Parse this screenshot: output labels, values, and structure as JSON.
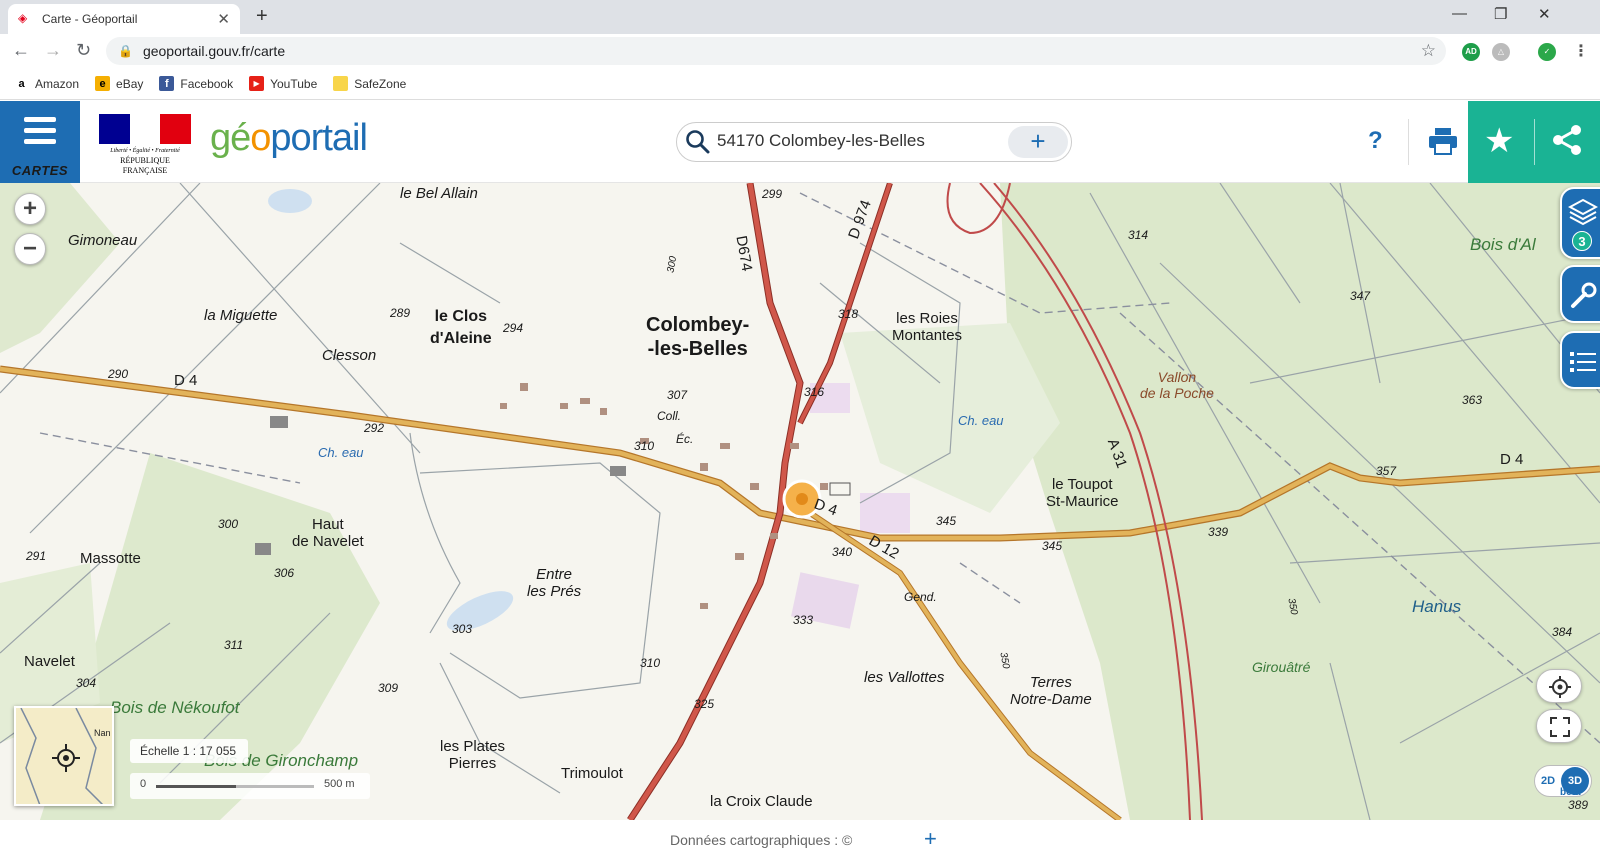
{
  "browser": {
    "tab_title": "Carte - Géoportail",
    "url": "geoportail.gouv.fr/carte",
    "bookmarks": [
      "Amazon",
      "eBay",
      "Facebook",
      "YouTube",
      "SafeZone"
    ],
    "ext_ad": "AD"
  },
  "header": {
    "menu_label": "CARTES",
    "rf_motto": "Liberté • Égalité • Fraternité",
    "rf_name": "RÉPUBLIQUE FRANÇAISE",
    "logo": {
      "part1": "gé",
      "part2": "o",
      "part3": "portail"
    },
    "search_value": "54170 Colombey-les-Belles",
    "help_label": "?"
  },
  "map": {
    "labels": {
      "bel_allain": "le Bel Allain",
      "gimoneau": "Gimoneau",
      "miguette": "la Miguette",
      "clos1": "le Clos",
      "clos2": "d'Aleine",
      "clesson": "Clesson",
      "town1": "Colombey-",
      "town2": "-les-Belles",
      "roies1": "les Roies",
      "roies2": "Montantes",
      "vallon1": "Vallon",
      "vallon2": "de la Poche",
      "bois_a": "Bois d'Al",
      "haut1": "Haut",
      "haut2": "de Navelet",
      "massotte": "Massotte",
      "entre1": "Entre",
      "entre2": "les Prés",
      "toupot1": "le Toupot",
      "toupot2": "St-Maurice",
      "navelet": "Navelet",
      "nekoufot": "Bois de Nékoufot",
      "gironchamp": "Bois de Gironchamp",
      "plates1": "les Plates",
      "plates2": "Pierres",
      "trimoulot": "Trimoulot",
      "croix": "la Croix Claude",
      "vallottes": "les Vallottes",
      "terres1": "Terres",
      "terres2": "Notre-Dame",
      "hanus": "Hanus",
      "girouatre": "Girouâtré",
      "ch_eau": "Ch. eau",
      "coll": "Coll.",
      "ec": "Éc.",
      "gend": "Gend.",
      "d4": "D 4",
      "d12": "D 12",
      "d674": "D674",
      "d974": "D 974",
      "a31": "A 31"
    },
    "altitudes": {
      "a299": "299",
      "a314": "314",
      "a347": "347",
      "a363": "363",
      "a289": "289",
      "a294": "294",
      "a318": "318",
      "a290": "290",
      "a292": "292",
      "a307": "307",
      "a316": "316",
      "a310": "310",
      "a357": "357",
      "a345": "345",
      "a345b": "345",
      "a339": "339",
      "a340": "340",
      "a300": "300",
      "a306": "306",
      "a291": "291",
      "a333": "333",
      "a303": "303",
      "a311": "311",
      "a310b": "310",
      "a309": "309",
      "a304": "304",
      "a325": "325",
      "a384": "384",
      "a350": "350",
      "a350b": "350",
      "a300b": "300",
      "a389": "389"
    },
    "overview_label": "Nan",
    "scale_text": "Échelle 1 : 17 055",
    "scale_bar": {
      "start": "0",
      "end": "500 m"
    },
    "mode_2d": "2D",
    "mode_3d": "3D",
    "beta": "bêta",
    "layers_count": "3"
  },
  "footer": {
    "attribution": "Données cartographiques : ©"
  },
  "colors": {
    "primary_blue": "#1e6db3",
    "teal": "#1ab394",
    "road_orange": "#d9a23a",
    "road_red": "#c0463a",
    "forest_green": "#d9e8c9"
  }
}
